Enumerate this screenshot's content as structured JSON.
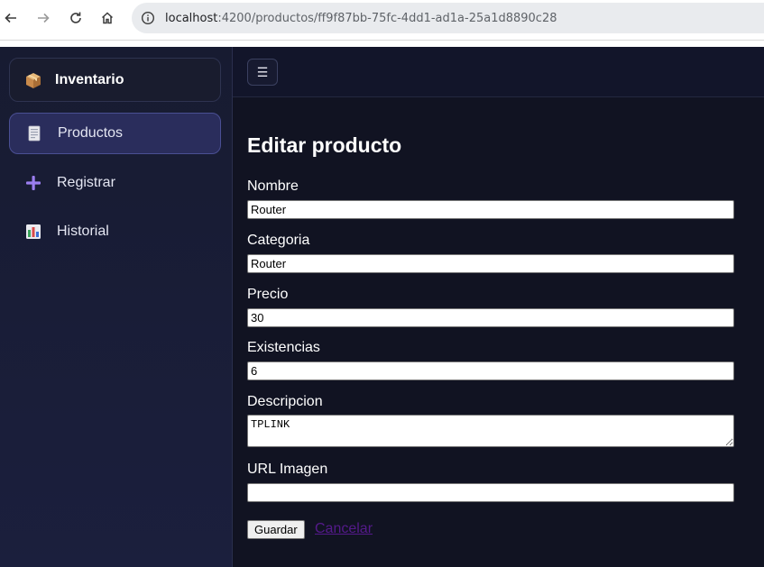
{
  "browser": {
    "url_host": "localhost",
    "url_rest": ":4200/productos/ff9f87bb-75fc-4dd1-ad1a-25a1d8890c28"
  },
  "sidebar": {
    "brand": "Inventario",
    "items": [
      {
        "label": "Productos",
        "icon": "document-icon",
        "active": true
      },
      {
        "label": "Registrar",
        "icon": "plus-icon",
        "active": false
      },
      {
        "label": "Historial",
        "icon": "bar-chart-icon",
        "active": false
      }
    ]
  },
  "topbar": {
    "menu_glyph": "☰"
  },
  "form": {
    "title": "Editar producto",
    "nombre": {
      "label": "Nombre",
      "value": "Router"
    },
    "categoria": {
      "label": "Categoria",
      "value": "Router"
    },
    "precio": {
      "label": "Precio",
      "value": "30"
    },
    "existencias": {
      "label": "Existencias",
      "value": "6"
    },
    "descripcion": {
      "label": "Descripcion",
      "value": "TPLINK"
    },
    "url_imagen": {
      "label": "URL Imagen",
      "value": ""
    },
    "save_label": "Guardar",
    "cancel_label": "Cancelar"
  }
}
